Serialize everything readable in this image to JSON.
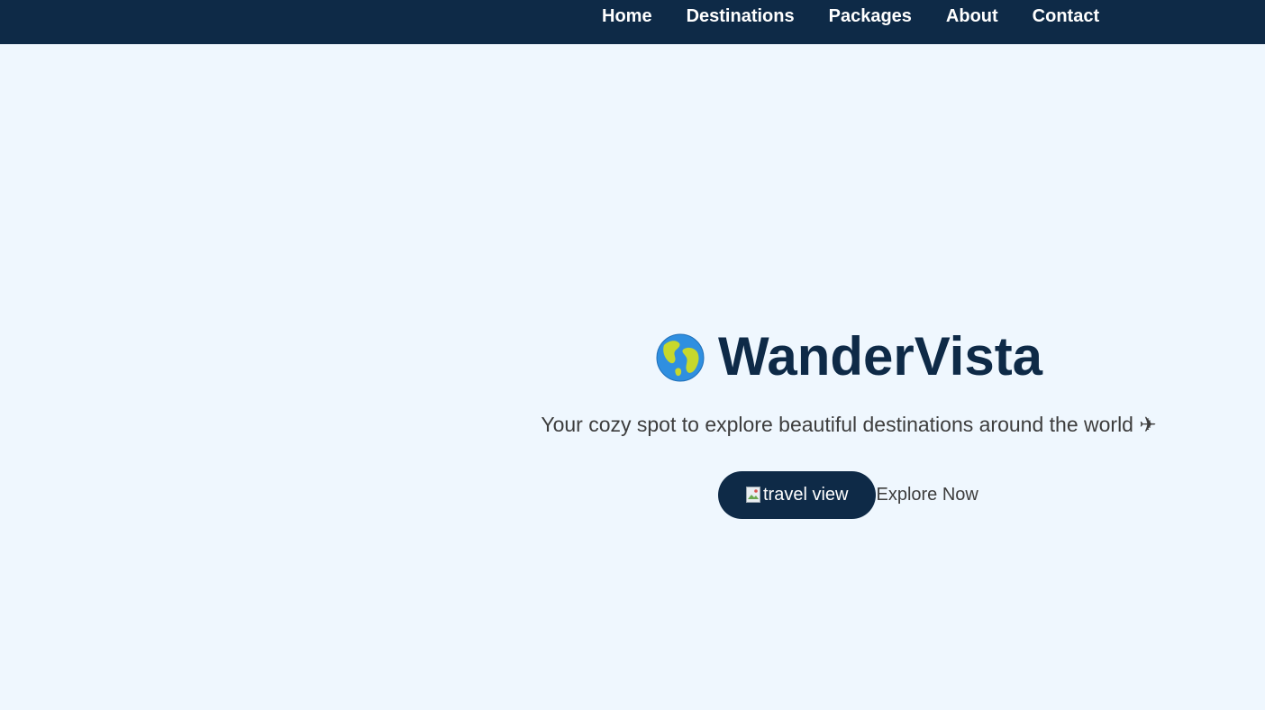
{
  "nav": {
    "items": [
      {
        "label": "Home"
      },
      {
        "label": "Destinations"
      },
      {
        "label": "Packages"
      },
      {
        "label": "About"
      },
      {
        "label": "Contact"
      }
    ]
  },
  "hero": {
    "icon": "globe-icon",
    "title": "WanderVista",
    "subtitle": "Your cozy spot to explore beautiful destinations around the world ✈",
    "image_alt": "travel view",
    "cta_label": "Explore Now"
  },
  "colors": {
    "navbar_bg": "#0e2a47",
    "page_bg": "#eff7fe",
    "title": "#0e2a47",
    "body_text": "#3d3d3d",
    "button_bg": "#0e2a47"
  }
}
